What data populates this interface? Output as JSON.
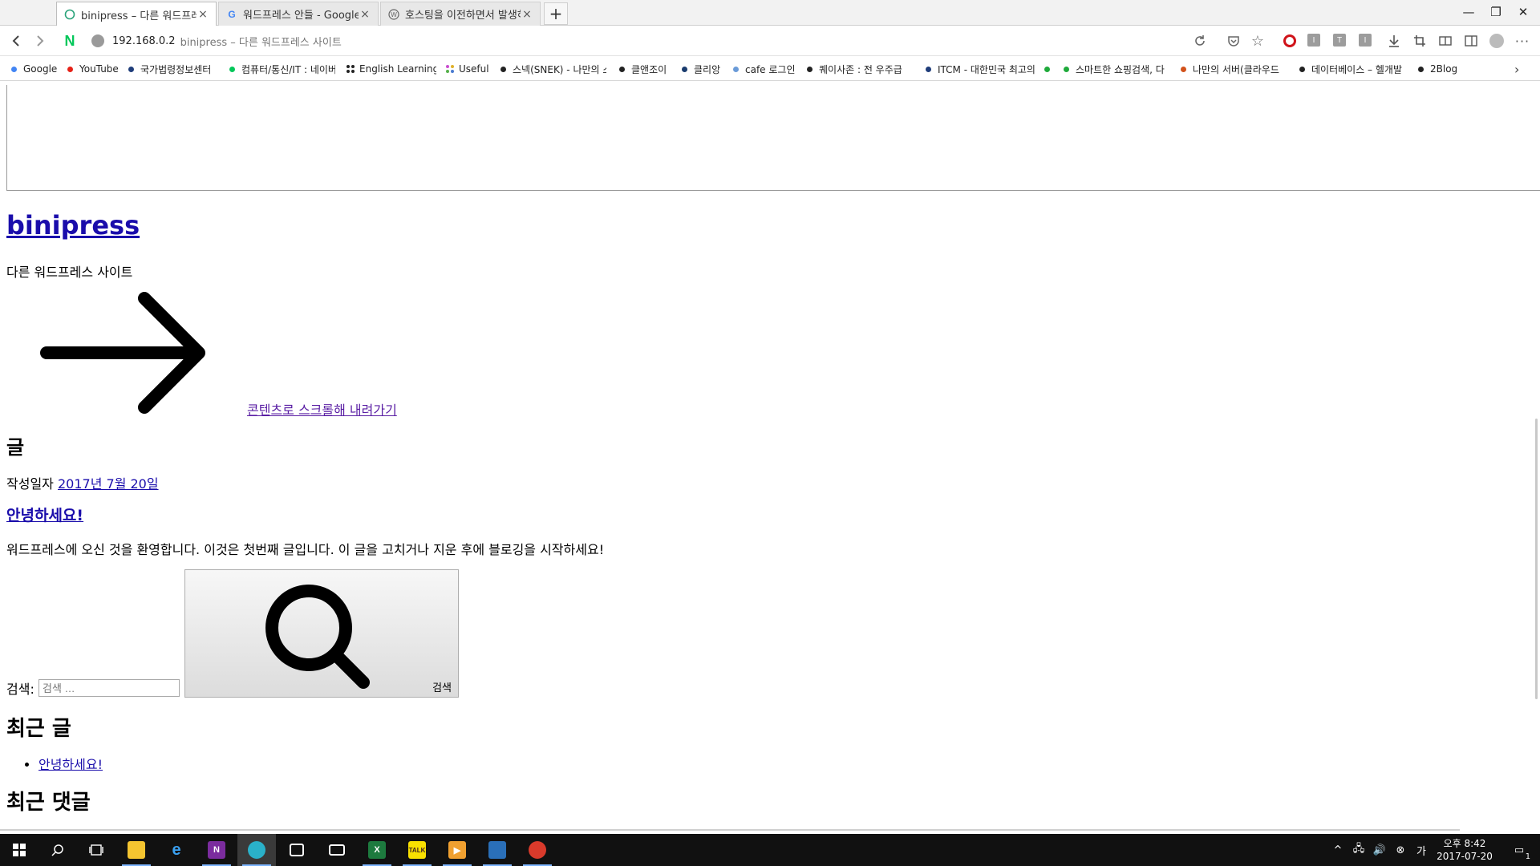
{
  "tabs": [
    {
      "title": "binipress – 다른 워드프레스",
      "favicon": "loading-circle-icon",
      "active": true
    },
    {
      "title": "워드프레스 안들 - Google 검색",
      "favicon": "google-g-icon",
      "active": false
    },
    {
      "title": "호스팅을 이전하면서 발생하",
      "favicon": "wordpress-icon",
      "active": false
    }
  ],
  "toolbar": {
    "host": "192.168.0.2",
    "page_title": "binipress – 다른 워드프레스 사이트"
  },
  "bookmarks": [
    {
      "label": "Google",
      "color": "#4285f4"
    },
    {
      "label": "YouTube",
      "color": "#e62117"
    },
    {
      "label": "국가법령정보센터",
      "color": "#1f3d7a"
    },
    {
      "label": "컴퓨터/통신/IT : 네이버",
      "color": "#03c75a"
    },
    {
      "label": "English Learning",
      "color": "#333333"
    },
    {
      "label": "Useful",
      "color": "#c94ecf"
    },
    {
      "label": "스넥(SNEK) - 나만의 스",
      "color": "#222222"
    },
    {
      "label": "클앤조이",
      "color": "#222222"
    },
    {
      "label": "클리앙",
      "color": "#1a3c6e"
    },
    {
      "label": "cafe 로그인",
      "color": "#6a9bd8"
    },
    {
      "label": "퀘이사존 : 전 우주급",
      "color": "#222222"
    },
    {
      "label": "ITCM - 대한민국 최고의",
      "color": "#1f3d7a"
    },
    {
      "label": "",
      "color": "#1faa3b"
    },
    {
      "label": "스마트한 쇼핑검색, 다",
      "color": "#1faa3b"
    },
    {
      "label": "나만의 서버(클라우드",
      "color": "#d2521b"
    },
    {
      "label": "데이터베이스 – 헬개발",
      "color": "#222222"
    },
    {
      "label": "2Blog",
      "color": "#222222"
    }
  ],
  "page": {
    "site_title": "binipress",
    "tagline": "다른 워드프레스 사이트",
    "skip_link": "콘텐츠로 스크롤해 내려가기",
    "posts_heading": "글",
    "posted_on_label": "작성일자",
    "posted_on_date": "2017년 7월 20일",
    "post_title": "안녕하세요!",
    "post_body": "워드프레스에 오신 것을 환영합니다. 이것은 첫번째 글입니다. 이 글을 고치거나 지운 후에 블로깅을 시작하세요!",
    "search_label": "검색:",
    "search_placeholder": "검색 …",
    "search_button": "검색",
    "recent_posts_heading": "최근 글",
    "recent_posts": [
      "안녕하세요!"
    ],
    "recent_comments_heading": "최근 댓글"
  },
  "taskbar": {
    "apps": [
      "windows-start",
      "search",
      "task-view",
      "file-explorer",
      "edge",
      "onenote",
      "whale-browser",
      "store",
      "mail",
      "excel",
      "kakaotalk",
      "media-player",
      "remote-app",
      "snake-app"
    ],
    "clock_time": "오후 8:42",
    "clock_date": "2017-07-20",
    "notification_count": "1"
  }
}
